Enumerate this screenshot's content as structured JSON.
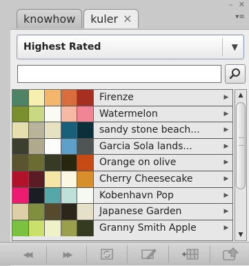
{
  "window": {
    "collapse_glyph": "–",
    "close_glyph": "✕",
    "menu_glyph": "▾≡"
  },
  "tabs": [
    {
      "label": "knowhow",
      "active": false
    },
    {
      "label": "kuler",
      "active": true,
      "close": "✕"
    }
  ],
  "filter": {
    "value": "Highest Rated",
    "arrow": "▼"
  },
  "search": {
    "value": "",
    "placeholder": ""
  },
  "themes": [
    {
      "name": "Firenze",
      "colors": [
        "#4e8366",
        "#f6efb0",
        "#f3b66a",
        "#d76e3b",
        "#a62f22"
      ]
    },
    {
      "name": "Watermelon",
      "colors": [
        "#7a8f2f",
        "#c9d883",
        "#fbfbf5",
        "#f6b9a4",
        "#ef8595"
      ]
    },
    {
      "name": "sandy stone beach...",
      "colors": [
        "#e5dfb0",
        "#b9b39b",
        "#e6e1c1",
        "#185f7a",
        "#0b2f3b"
      ]
    },
    {
      "name": "Garcia Sola lands...",
      "colors": [
        "#3d3f2e",
        "#b1a98d",
        "#fcfcfb",
        "#5e9fc9",
        "#4e5554"
      ]
    },
    {
      "name": "Orange on olive",
      "colors": [
        "#5a5431",
        "#6a6c32",
        "#373b23",
        "#27260f",
        "#c64a14"
      ]
    },
    {
      "name": "Cherry Cheesecake",
      "colors": [
        "#b1132b",
        "#5c1c23",
        "#f6e6a6",
        "#fbf7e3",
        "#d88e2b"
      ]
    },
    {
      "name": "Kobenhavn Pop",
      "colors": [
        "#ec1c70",
        "#1a1d24",
        "#56a8a8",
        "#bfe0d8",
        "#f6f9f2"
      ]
    },
    {
      "name": "Japanese Garden",
      "colors": [
        "#ddcfa7",
        "#7f8e3f",
        "#554b2c",
        "#2c2519",
        "#e6e0c8"
      ]
    },
    {
      "name": "Granny Smith Apple",
      "colors": [
        "#7cc241",
        "#cbe06a",
        "#eff1c6",
        "#9a9f4d",
        "#353b21"
      ]
    }
  ],
  "list_row_arrow": "▶",
  "scroll": {
    "up": "▲",
    "down": "▼",
    "position": 0.0
  },
  "toolbar": {
    "icons": [
      "previous-icon",
      "next-icon",
      "refresh-icon",
      "edit-theme-icon",
      "add-to-swatches-icon",
      "upload-icon"
    ],
    "prev_glyph": "◀◀",
    "next_glyph": "▶▶"
  }
}
